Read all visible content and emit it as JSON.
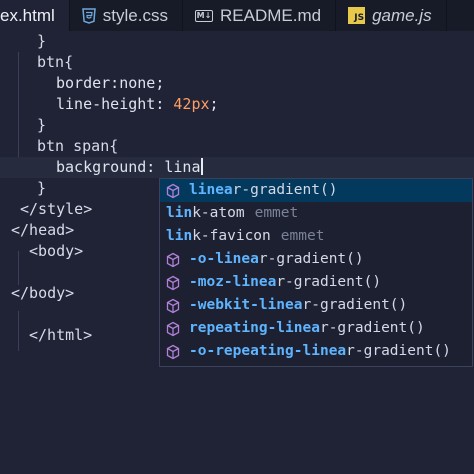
{
  "tabs": [
    {
      "label": "ex.html",
      "icon": "html-icon",
      "active": true
    },
    {
      "label": "style.css",
      "icon": "css3-icon",
      "active": false
    },
    {
      "label": "README.md",
      "icon": "markdown-icon",
      "active": false
    },
    {
      "label": "game.js",
      "icon": "javascript-icon",
      "active": false
    }
  ],
  "code": {
    "l1": "}",
    "l2": "btn{",
    "l3_prop": "border:none;",
    "l4_prop": "line-height: ",
    "l4_num": "42px",
    "l4_end": ";",
    "l5": "}",
    "l6": "btn span{",
    "l7_text": "background: lina",
    "l8": "}",
    "l9": "</style>",
    "l10": "</head>",
    "l11": "<body>",
    "l12": "</body>",
    "l13": "</html>"
  },
  "suggestions": [
    {
      "pre": "lin",
      "hl": "ea",
      "rest": "r-gradient()",
      "detail": ""
    },
    {
      "pre": "lin",
      "hl": "",
      "rest": "k-atom",
      "detail": "emmet"
    },
    {
      "pre": "lin",
      "hl": "",
      "rest": "k-favicon",
      "detail": "emmet"
    },
    {
      "pre": "-o-lin",
      "hl": "ea",
      "rest": "r-gradient()",
      "detail": ""
    },
    {
      "pre": "-moz-lin",
      "hl": "ea",
      "rest": "r-gradient()",
      "detail": ""
    },
    {
      "pre": "-webkit-lin",
      "hl": "ea",
      "rest": "r-gradient()",
      "detail": ""
    },
    {
      "pre": "repeating-lin",
      "hl": "ea",
      "rest": "r-gradient()",
      "detail": ""
    },
    {
      "pre": "-o-repeating-lin",
      "hl": "ea",
      "rest": "r-gradient()",
      "detail": ""
    }
  ],
  "colors": {
    "accent": "#5fb4ff",
    "selection": "#04395e",
    "property_icon": "#b180d7",
    "js_badge": "#e6c84a"
  }
}
